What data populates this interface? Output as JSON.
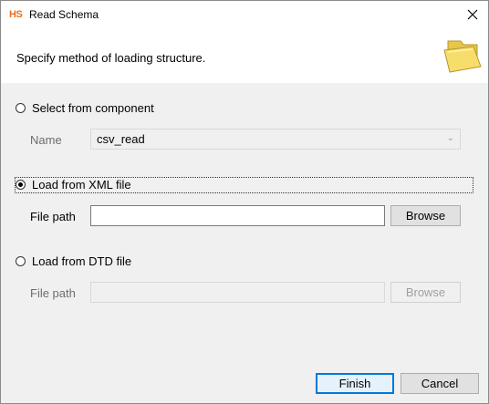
{
  "window": {
    "logo": "HS",
    "title": "Read Schema",
    "close_icon": "close-icon"
  },
  "header": {
    "text": "Specify method of loading structure.",
    "icon": "folder-icon"
  },
  "options": {
    "component": {
      "label": "Select from component",
      "checked": false,
      "name_label": "Name",
      "name_value": "csv_read"
    },
    "xml": {
      "label": "Load from XML file",
      "checked": true,
      "path_label": "File path",
      "path_value": "",
      "browse_label": "Browse"
    },
    "dtd": {
      "label": "Load from DTD file",
      "checked": false,
      "path_label": "File path",
      "path_value": "",
      "browse_label": "Browse"
    }
  },
  "footer": {
    "finish_label": "Finish",
    "cancel_label": "Cancel"
  },
  "colors": {
    "accent": "#0078d7",
    "logo": "#e8701a",
    "folder": "#f5d55a"
  }
}
